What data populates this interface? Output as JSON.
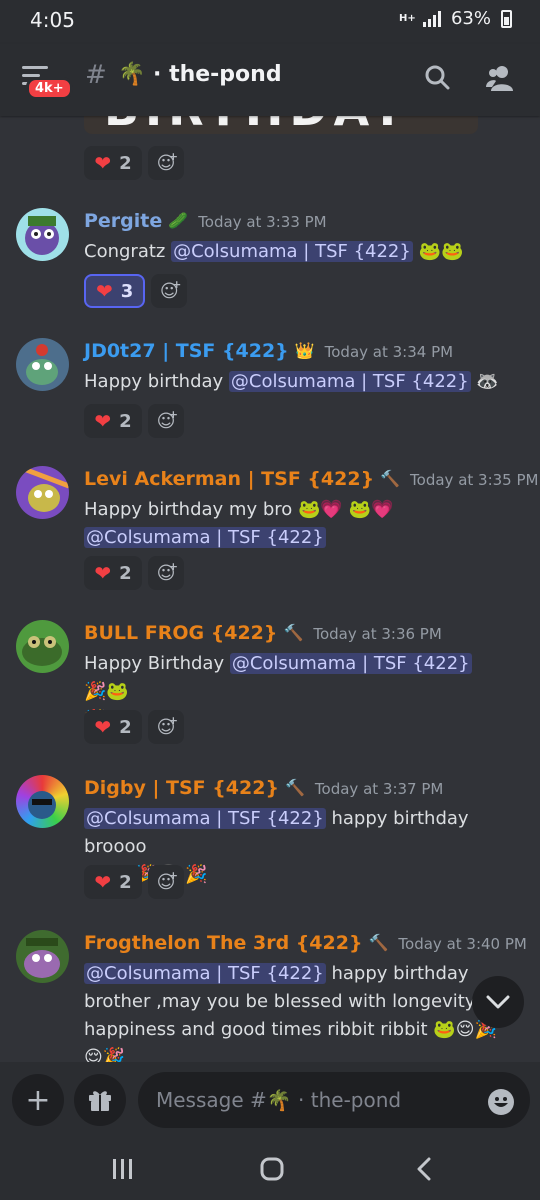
{
  "status_bar": {
    "time": "4:05",
    "battery": "63%",
    "network": "H+"
  },
  "header": {
    "unread_badge": "4k+",
    "channel_name": "🌴 · the-pond"
  },
  "top_image_text": "BIRTHDAY",
  "reactions": {
    "first": {
      "heart_count": "2"
    }
  },
  "messages": [
    {
      "author": "Pergite",
      "author_color": "#7ea6e0",
      "timestamp": "Today at 3:33 PM",
      "text_before": "Congratz ",
      "mention": "@Colsumama | TSF {422}",
      "text_after": "",
      "emoji": "🐸🐸",
      "reaction_count": "3",
      "reaction_active": true
    },
    {
      "author": "JD0t27 | TSF {422}",
      "author_color": "#3b9cf0",
      "timestamp": "Today at 3:34 PM",
      "text_before": "Happy birthday ",
      "mention": "@Colsumama | TSF {422}",
      "emoji": "🦝",
      "reaction_count": "2"
    },
    {
      "author": "Levi Ackerman | TSF {422}",
      "author_color": "#e8821a",
      "timestamp": "Today at 3:35 PM",
      "text_before": "Happy birthday my bro ",
      "emoji_before": "🐸💗 🐸💗",
      "mention": "@Colsumama | TSF {422}",
      "reaction_count": "2"
    },
    {
      "author": "BULL FROG {422}",
      "author_color": "#e8821a",
      "timestamp": "Today at 3:36 PM",
      "text_before": "Happy Birthday ",
      "mention": "@Colsumama | TSF {422}",
      "emoji": "🎉🐸",
      "emoji_line2": "🎉",
      "reaction_count": "2"
    },
    {
      "author": "Digby | TSF {422}",
      "author_color": "#e8821a",
      "timestamp": "Today at 3:37 PM",
      "mention": "@Colsumama | TSF {422}",
      "text_after": " happy birthday broooo",
      "emoji_line2": "👀🐸 🎉🎂 🎉",
      "reaction_count": "2"
    },
    {
      "author": "Frogthelon The 3rd {422}",
      "author_color": "#e8821a",
      "timestamp": "Today at 3:40 PM",
      "mention": "@Colsumama | TSF {422}",
      "text_after": " happy birthday",
      "line2": "brother ,may you be blessed with longevity,",
      "line3": "happiness and good times ribbit ribbit",
      "emoji_line3": "🐸😌🎉",
      "emoji_line4": "😌🎉"
    }
  ],
  "composer": {
    "placeholder": "Message #🌴 · the-pond"
  },
  "icons": {
    "menu": "hamburger-icon",
    "search": "search-icon",
    "members": "members-icon",
    "add": "plus-icon",
    "gift": "gift-icon",
    "emoji": "emoji-icon",
    "scroll": "chevron-down-icon",
    "nav_recents": "recents-icon",
    "nav_home": "home-icon",
    "nav_back": "back-icon"
  }
}
